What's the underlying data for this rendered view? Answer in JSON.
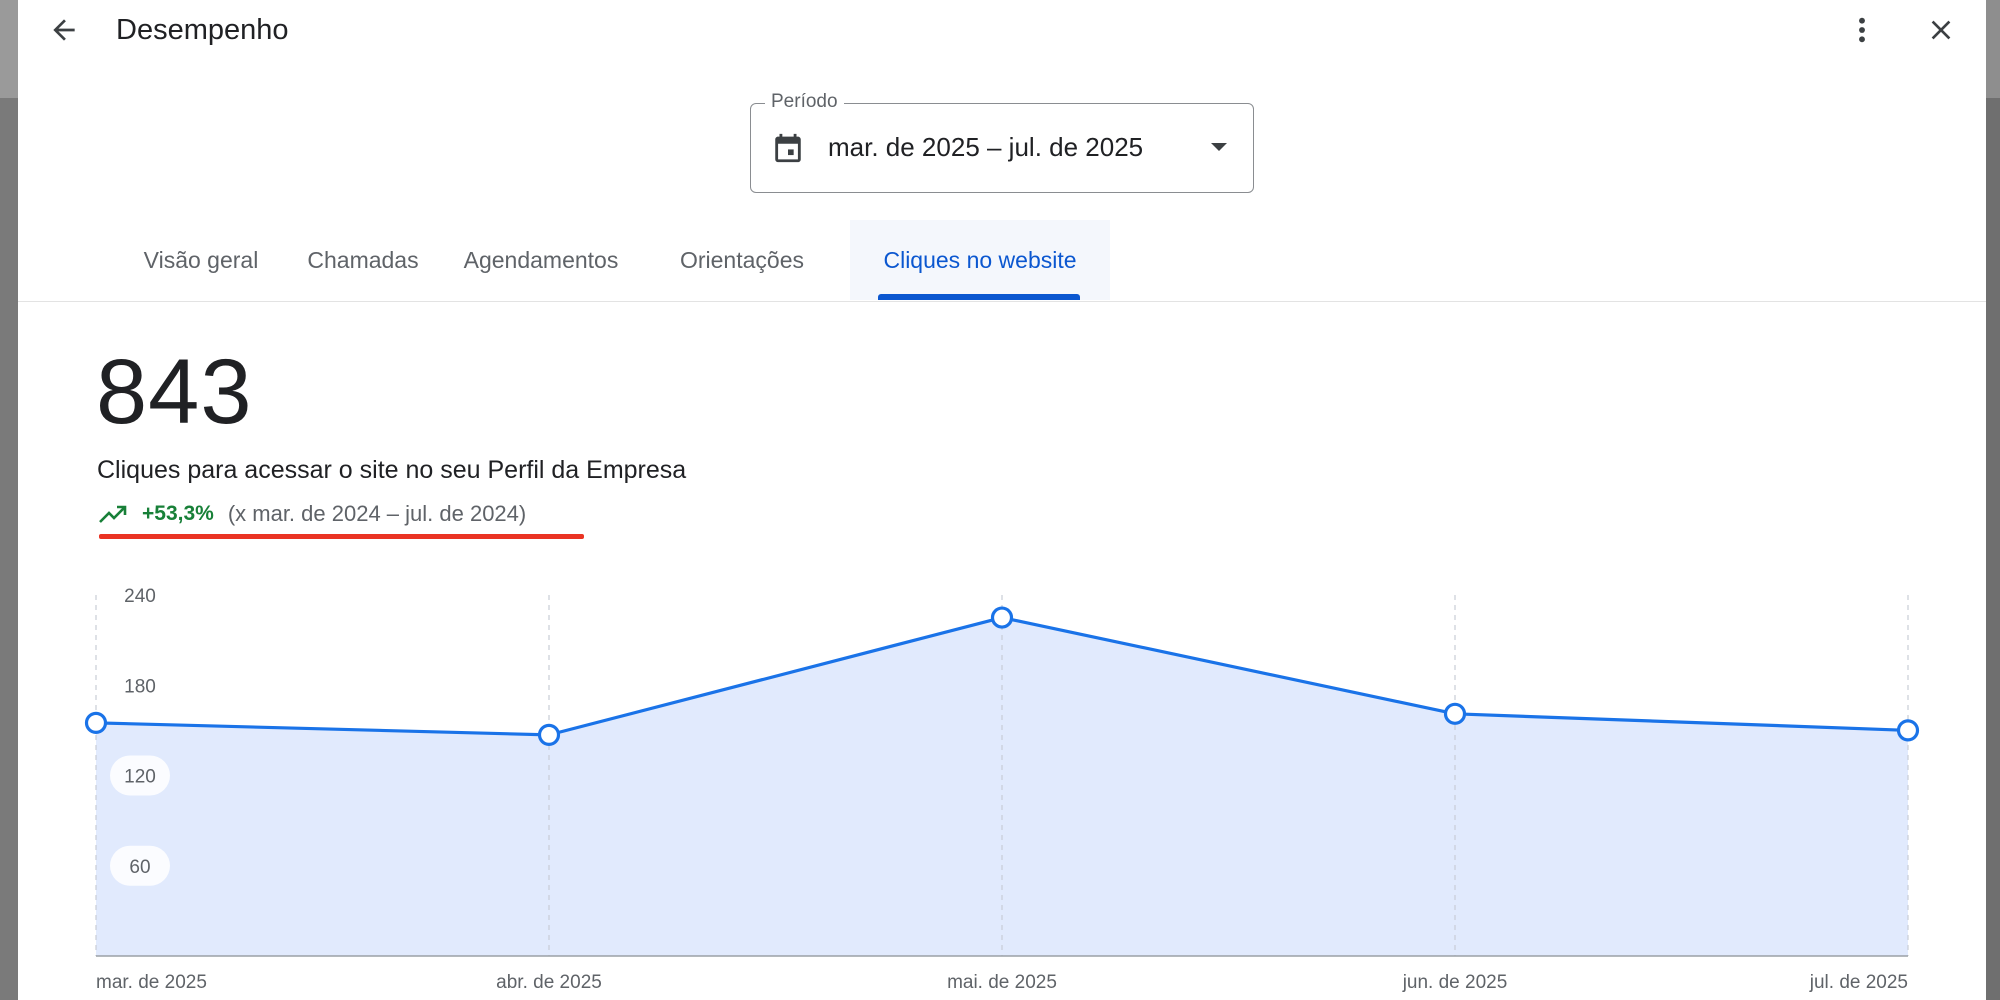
{
  "header": {
    "title": "Desempenho",
    "back_icon": "arrow-back-icon",
    "more_icon": "more-vert-icon",
    "close_icon": "close-icon"
  },
  "period": {
    "label": "Período",
    "value": "mar. de 2025 – jul. de 2025",
    "icon": "calendar-icon"
  },
  "tabs": [
    {
      "label": "Visão geral",
      "active": false
    },
    {
      "label": "Chamadas",
      "active": false
    },
    {
      "label": "Agendamentos",
      "active": false
    },
    {
      "label": "Orientações",
      "active": false
    },
    {
      "label": "Cliques no website",
      "active": true
    }
  ],
  "metric": {
    "value": "843",
    "label": "Cliques para acessar o site no seu Perfil da Empresa",
    "trend_value": "+53,3%",
    "trend_compare": "(x mar. de 2024 – jul. de 2024)",
    "trend_icon": "trending-up-icon"
  },
  "colors": {
    "accent": "#0b57d0",
    "line": "#1a73e8",
    "area": "#e1eafd",
    "positive": "#188038",
    "highlight": "#ea3323"
  },
  "chart_data": {
    "type": "area",
    "categories": [
      "mar. de 2025",
      "abr. de 2025",
      "mai. de 2025",
      "jun. de 2025",
      "jul. de 2025"
    ],
    "values": [
      155,
      147,
      225,
      161,
      150
    ],
    "y_ticks": [
      "240",
      "180",
      "120",
      "60"
    ],
    "ylim": [
      0,
      240
    ],
    "grid": "vertical-dashed",
    "title": "",
    "xlabel": "",
    "ylabel": ""
  }
}
